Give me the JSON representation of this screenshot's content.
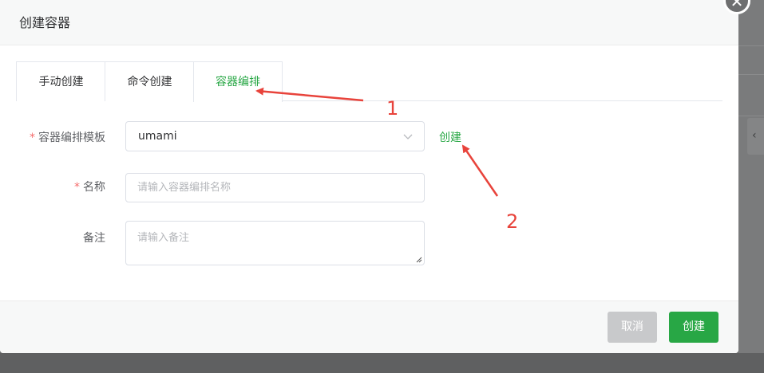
{
  "dialog": {
    "title": "创建容器",
    "close_symbol": "✕"
  },
  "tabs": [
    {
      "label": "手动创建",
      "active": false
    },
    {
      "label": "命令创建",
      "active": false
    },
    {
      "label": "容器编排",
      "active": true
    }
  ],
  "form": {
    "template": {
      "label": "容器编排模板",
      "required_mark": "*",
      "value": "umami"
    },
    "name": {
      "label": "名称",
      "required_mark": "*",
      "placeholder": "请输入容器编排名称"
    },
    "remark": {
      "label": "备注",
      "placeholder": "请输入备注"
    },
    "create_link": "创建"
  },
  "footer": {
    "cancel_label": "取消",
    "confirm_label": "创建"
  },
  "annotations": {
    "marker1": "1",
    "marker2": "2",
    "color": "#e8433b"
  },
  "colors": {
    "accent": "#28a745",
    "required": "#f56c6c",
    "overlay": "#6e6f70"
  },
  "icons": {
    "select_arrow": "chevron-down-icon",
    "close": "close-icon"
  }
}
